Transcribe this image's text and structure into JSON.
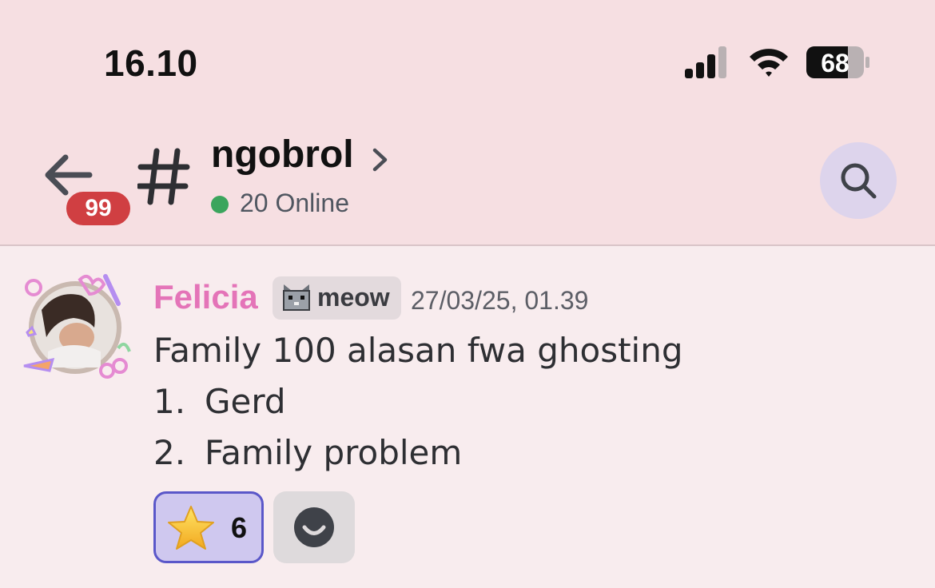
{
  "status_bar": {
    "time": "16.10",
    "battery": "68",
    "icons": [
      "signal-icon",
      "wifi-icon",
      "battery-icon"
    ]
  },
  "header": {
    "back_badge": "99",
    "channel_name": "ngobrol",
    "online": "20 Online",
    "icons": [
      "back-arrow-icon",
      "hash-icon",
      "chevron-right-icon",
      "search-icon"
    ],
    "online_color": "#3ba55d"
  },
  "message": {
    "author": "Felicia",
    "author_color": "#e474b8",
    "tag": "meow",
    "timestamp": "27/03/25, 01.39",
    "text": "Family 100 alasan fwa ghosting",
    "list": [
      {
        "num": "1.",
        "text": "Gerd"
      },
      {
        "num": "2.",
        "text": "Family problem"
      }
    ]
  },
  "reactions": [
    {
      "emoji": "star-icon",
      "count": "6"
    }
  ],
  "colors": {
    "header_bg": "#f6dfe2",
    "chat_bg": "#f8ecee",
    "badge_red": "#d03f42",
    "reaction_active": "#cfc8ef",
    "reaction_border": "#5a57c9"
  }
}
